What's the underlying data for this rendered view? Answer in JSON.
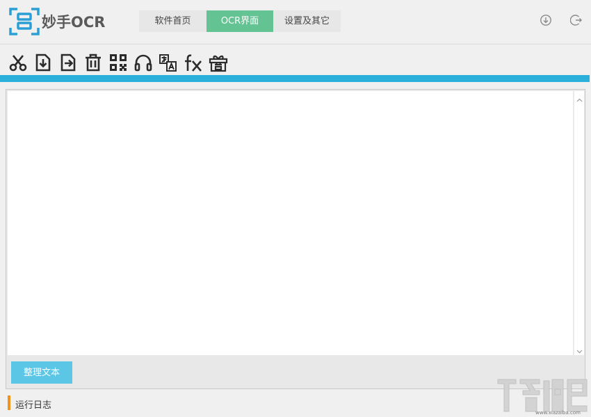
{
  "app": {
    "title": "妙手OCR"
  },
  "tabs": [
    {
      "label": "软件首页",
      "active": false
    },
    {
      "label": "OCR界面",
      "active": true
    },
    {
      "label": "设置及其它",
      "active": false
    }
  ],
  "header_icons": [
    "download-icon",
    "logout-icon"
  ],
  "toolbar": {
    "tools": [
      "scissors-icon",
      "import-file-icon",
      "export-file-icon",
      "trash-icon",
      "qrcode-icon",
      "headphones-icon",
      "translate-icon",
      "formula-icon",
      "gift-reward-icon"
    ]
  },
  "editor": {
    "value": "",
    "tidy_button": "整理文本"
  },
  "log": {
    "label": "运行日志"
  },
  "watermark": {
    "url": "www.xiazaiba.com"
  },
  "colors": {
    "accent": "#2bb0dc",
    "active_tab": "#63c393",
    "button": "#5bc6e6",
    "log_marker": "#f0931c",
    "logo": "#2a9fd6"
  }
}
